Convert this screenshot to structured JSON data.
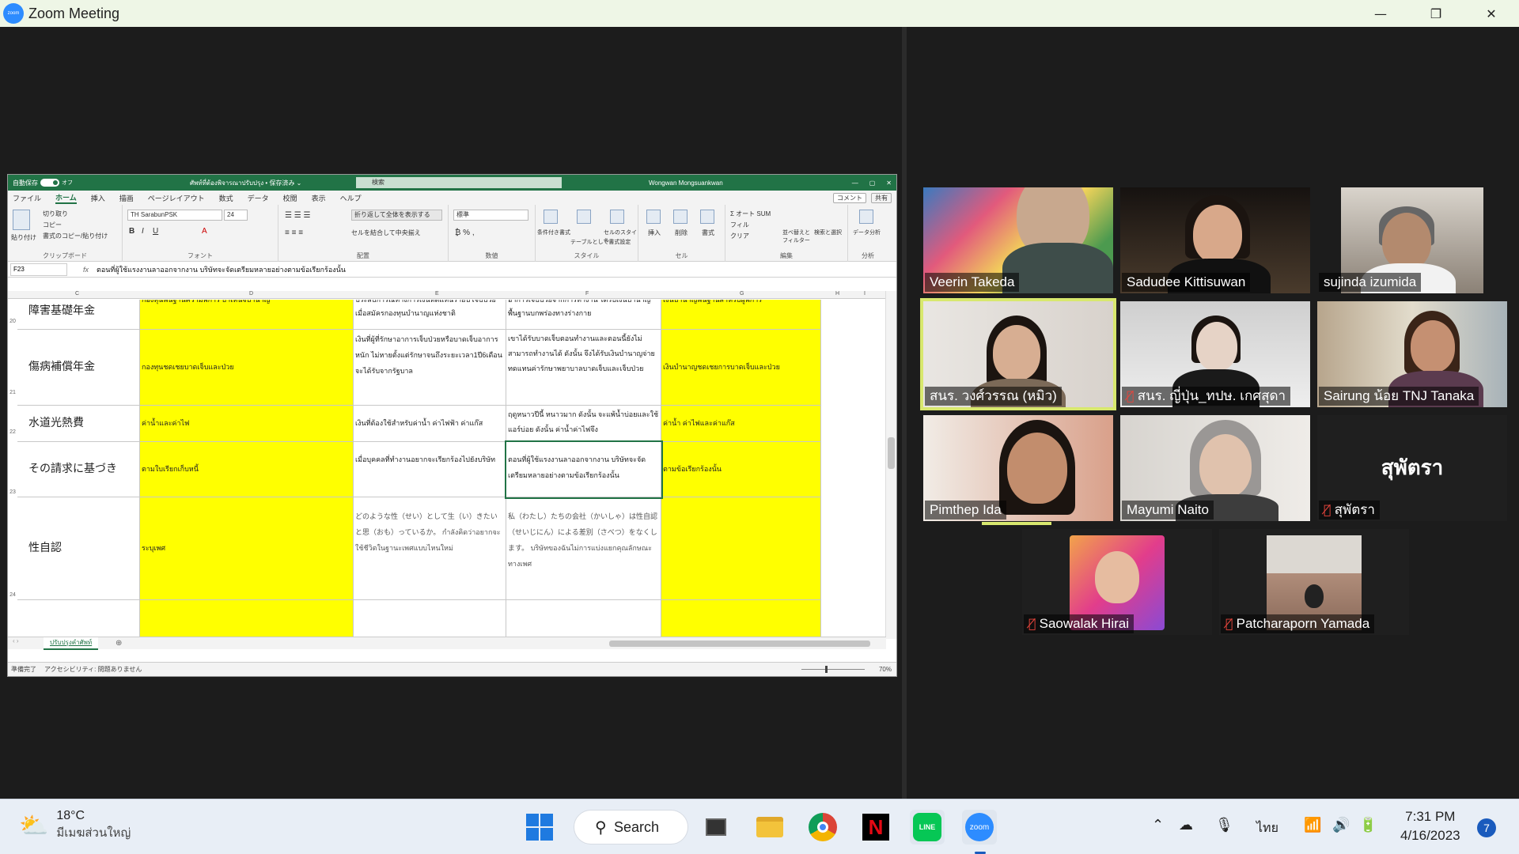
{
  "window": {
    "title": "Zoom Meeting",
    "logo_text": "zoom",
    "minimize": "—",
    "maximize": "❐",
    "close": "✕"
  },
  "excel": {
    "autosave_label": "自動保存",
    "autosave_state": "オフ",
    "filename": "ศัพท์ที่ต้องพิจารณาปรับปรุง • 保存済み ⌄",
    "search_placeholder": "検索",
    "user": "Wongwan Mongsuankwan",
    "menu": [
      "ファイル",
      "ホーム",
      "挿入",
      "描画",
      "ページレイアウト",
      "数式",
      "データ",
      "校閲",
      "表示",
      "ヘルプ"
    ],
    "comment_btn": "コメント",
    "share_btn": "共有",
    "ribbon": {
      "clipboard_label": "クリップボード",
      "paste": "貼り付け",
      "cut": "切り取り",
      "copy": "コピー",
      "format_painter": "書式のコピー/貼り付け",
      "font_name": "TH SarabunPSK",
      "font_size": "24",
      "font_label": "フォント",
      "wrap_text": "折り返して全体を表示する",
      "merge_center": "セルを結合して中央揃え",
      "align_label": "配置",
      "number_format": "標準",
      "number_label": "数値",
      "style_items": [
        "条件付き書式",
        "テーブルとして書式設定",
        "セルのスタイル"
      ],
      "style_label": "スタイル",
      "cell_items": [
        "挿入",
        "削除",
        "書式"
      ],
      "cell_label": "セル",
      "autosum": "オート SUM",
      "fill": "フィル",
      "clear": "クリア",
      "sort": "並べ替えとフィルター",
      "find": "検索と選択",
      "edit_label": "編集",
      "analyze": "データ分析",
      "analyze_label": "分析"
    },
    "namebox": "F23",
    "formula": "ตอนที่ผู้ใช้แรงงานลาออกจากงาน บริษัทจะจัดเตรียมหลายอย่างตามข้อเรียกร้องนั้น",
    "columns": [
      "C",
      "D",
      "E",
      "F",
      "G",
      "H",
      "I"
    ],
    "rows": [
      {
        "num": "20",
        "c": "障害基礎年金",
        "d": "กองทุนพื้นฐานความพิการ บำเหน็จบำนาญ",
        "e": "ประสบการณ์ทางการเงินทดแทนรายปี เจ็บป่วยเมื่อสมัครกองทุนบำนาญแห่งชาติ",
        "f": "อาการเจ็บป่วยจากการทำงาน ได้รับเงินบำนาญพื้นฐานบกพร่องทางร่างกาย",
        "g": "เงินบำนาญพื้นฐานสำหรับผู้พิการ"
      },
      {
        "num": "21",
        "c": "傷病補償年金",
        "d": "กองทุนชดเชยบาดเจ็บและป่วย",
        "e": "เงินที่ผู้ที่รักษาอาการเจ็บป่วยหรือบาดเจ็บอาการหนัก ไม่หายตั้งแต่รักษาจนถึงระยะเวลา1ปี6เดือน จะได้รับจากรัฐบาล",
        "f": "เขาได้รับบาดเจ็บตอนทำงานและตอนนี้ยังไม่สามารถทำงานได้ ดังนั้น จึงได้รับเงินบำนาญจ่ายทดแทนค่ารักษาพยาบาลบาดเจ็บและเจ็บป่วย",
        "g": "เงินบำนาญชดเชยการบาดเจ็บและป่วย"
      },
      {
        "num": "22",
        "c": "水道光熱費",
        "d": "ค่าน้ำและค่าไฟ",
        "e": "เงินที่ต้องใช้สำหรับค่าน้ำ ค่าไฟฟ้า ค่าแก๊ส",
        "f": "ฤดูหนาวปีนี้ หนาวมาก ดังนั้น จะแพ้น้ำบ่อยและใช้แอร์บ่อย ดังนั้น ค่าน้ำค่าไฟจึง",
        "g": "ค่าน้ำ ค่าไฟและค่าแก๊ส"
      },
      {
        "num": "23",
        "c": "その請求に基づき",
        "d": "ตามใบเรียกเก็บหนี้",
        "e": "เมื่อบุคคลที่ทำงานอยากจะเรียกร้องไปยังบริษัท",
        "f": "ตอนที่ผู้ใช้แรงงานลาออกจากงาน บริษัทจะจัดเตรียมหลายอย่างตามข้อเรียกร้องนั้น",
        "g": "ตามข้อเรียกร้องนั้น"
      },
      {
        "num": "24",
        "c": "性自認",
        "d": "ระบุเพศ",
        "e": "どのような性（せい）として生（い）きたいと思（おも）っているか。 กำลังคิดว่าอยากจะใช้ชีวิตในฐานะเพศแบบไหนใหม่",
        "f": "私（わたし）たちの会社（かいしゃ）は性自認（せいじにん）による差別（さべつ）をなくします。 บริษัทของฉันไม่การแบ่งแยกคุณลักษณะทางเพศ",
        "g": ""
      }
    ],
    "sheet_tab": "ปรับปรุงคำศัพท์",
    "status_ready": "準備完了",
    "status_access": "アクセシビリティ: 問題ありません",
    "zoom_level": "70%"
  },
  "participants": [
    {
      "name": "Veerin Takeda",
      "muted": false
    },
    {
      "name": "Sadudee Kittisuwan",
      "muted": false
    },
    {
      "name": "sujinda izumida",
      "muted": false
    },
    {
      "name": "สนร. วงศ์วรรณ (หมิว)",
      "muted": false,
      "speaking": true
    },
    {
      "name": "สนร. ญี่ปุ่น_ทปษ. เกศสุดา",
      "muted": true
    },
    {
      "name": "Sairung  น้อย TNJ Tanaka",
      "muted": false
    },
    {
      "name": "Pimthep Ida",
      "muted": false
    },
    {
      "name": "Mayumi Naito",
      "muted": false
    },
    {
      "name": "สุพัตรา",
      "muted": true,
      "video_off": true
    },
    {
      "name": "Saowalak Hirai",
      "muted": true
    },
    {
      "name": "Patcharaporn Yamada",
      "muted": true
    }
  ],
  "taskbar": {
    "temperature": "18°C",
    "weather": "มีเมฆส่วนใหญ่",
    "search": "Search",
    "language": "ไทย",
    "time": "7:31 PM",
    "date": "4/16/2023",
    "notification_count": "7",
    "colors": {
      "line": "#06c755",
      "zoom": "#2d8cff",
      "netflix": "#e50914"
    }
  }
}
